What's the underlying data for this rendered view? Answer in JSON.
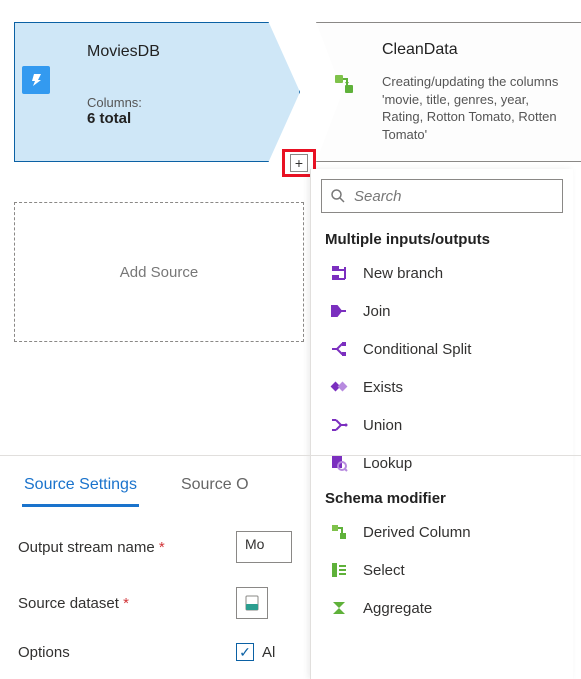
{
  "nodes": {
    "source": {
      "title": "MoviesDB",
      "columns_label": "Columns:",
      "columns_value": "6 total"
    },
    "clean": {
      "title": "CleanData",
      "desc": "Creating/updating the columns 'movie, title, genres, year, Rating, Rotton Tomato, Rotten Tomato'"
    }
  },
  "add_source_label": "Add Source",
  "plus_glyph": "+",
  "dropdown": {
    "search_placeholder": "Search",
    "group1_header": "Multiple inputs/outputs",
    "group1_items": [
      {
        "label": "New branch",
        "icon": "branch"
      },
      {
        "label": "Join",
        "icon": "join"
      },
      {
        "label": "Conditional Split",
        "icon": "cond-split"
      },
      {
        "label": "Exists",
        "icon": "exists"
      },
      {
        "label": "Union",
        "icon": "union"
      },
      {
        "label": "Lookup",
        "icon": "lookup"
      }
    ],
    "group2_header": "Schema modifier",
    "group2_items": [
      {
        "label": "Derived Column",
        "icon": "derived"
      },
      {
        "label": "Select",
        "icon": "select"
      },
      {
        "label": "Aggregate",
        "icon": "aggregate"
      }
    ]
  },
  "settings": {
    "tabs": {
      "active": "Source Settings",
      "other": "Source O",
      "last": "O"
    },
    "output_stream_label": "Output stream name",
    "output_stream_value": "Mo",
    "source_dataset_label": "Source dataset",
    "options_label": "Options",
    "options_checkbox_label": "Al",
    "checkbox_glyph": "✓"
  },
  "icon_colors": {
    "purple": "#7b2fbf",
    "green": "#5fb13a",
    "teal": "#2b9e8f"
  }
}
